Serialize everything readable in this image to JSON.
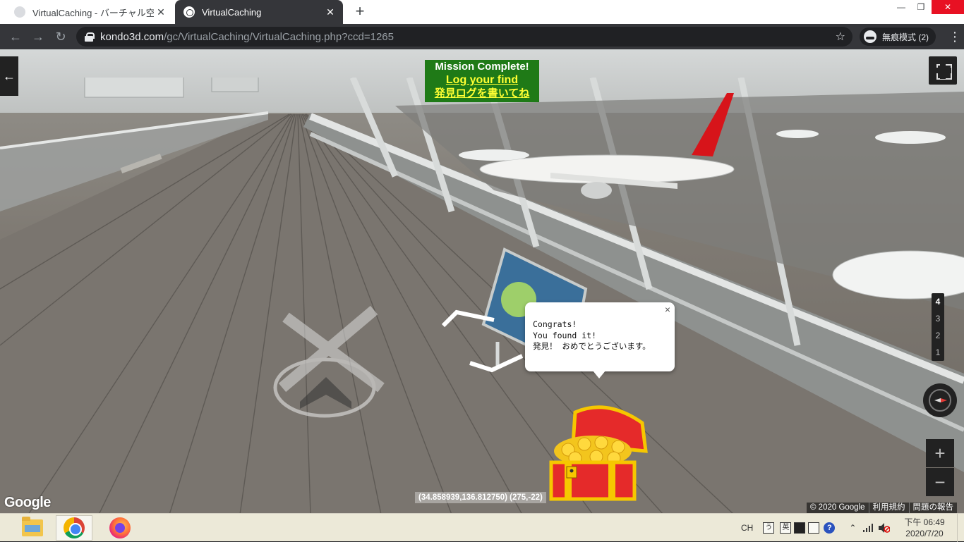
{
  "browser": {
    "tabs": [
      {
        "title": "VirtualCaching - バーチャル空間",
        "active": false
      },
      {
        "title": "VirtualCaching",
        "active": true
      }
    ],
    "new_tab_label": "+",
    "close_glyph": "✕",
    "window_controls": {
      "minimize": "—",
      "restore": "❐",
      "close": "✕"
    },
    "nav": {
      "back": "←",
      "forward": "→",
      "reload": "↻"
    },
    "url_host": "kondo3d.com",
    "url_path": "/gc/VirtualCaching/VirtualCaching.php?ccd=1265",
    "bookmark_glyph": "☆",
    "incognito_label": "無痕模式 (2)",
    "menu_glyph": "⋮"
  },
  "streetview": {
    "back_glyph": "←",
    "mission": {
      "title": "Mission Complete!",
      "log_link": "Log your find",
      "log_link_ja": "発見ログを書いてね"
    },
    "info_bubble": {
      "close_glyph": "×",
      "lines": [
        "Congrats!",
        "You found it!",
        "発見！ おめでとうございます。"
      ]
    },
    "levels": [
      "4",
      "3",
      "2",
      "1"
    ],
    "selected_level": "4",
    "zoom_in": "+",
    "zoom_out": "−",
    "coords": "(34.858939,136.812750) (275,-22)",
    "google_logo": "Google",
    "attribution": [
      "© 2020 Google",
      "利用規約",
      "問題の報告"
    ]
  },
  "taskbar": {
    "apps": [
      "file-explorer",
      "chrome",
      "firefox"
    ],
    "ime_label": "CH",
    "ime_boxes": [
      "う",
      "英"
    ],
    "help_glyph": "?",
    "tray_arrow": "⌃",
    "clock_time": "下午 06:49",
    "clock_date": "2020/7/20"
  },
  "colors": {
    "mission_bg": "#1f7a17",
    "mission_link": "#ffff33",
    "chrome_dark": "#35363a",
    "taskbar_bg": "#ece9d8"
  }
}
